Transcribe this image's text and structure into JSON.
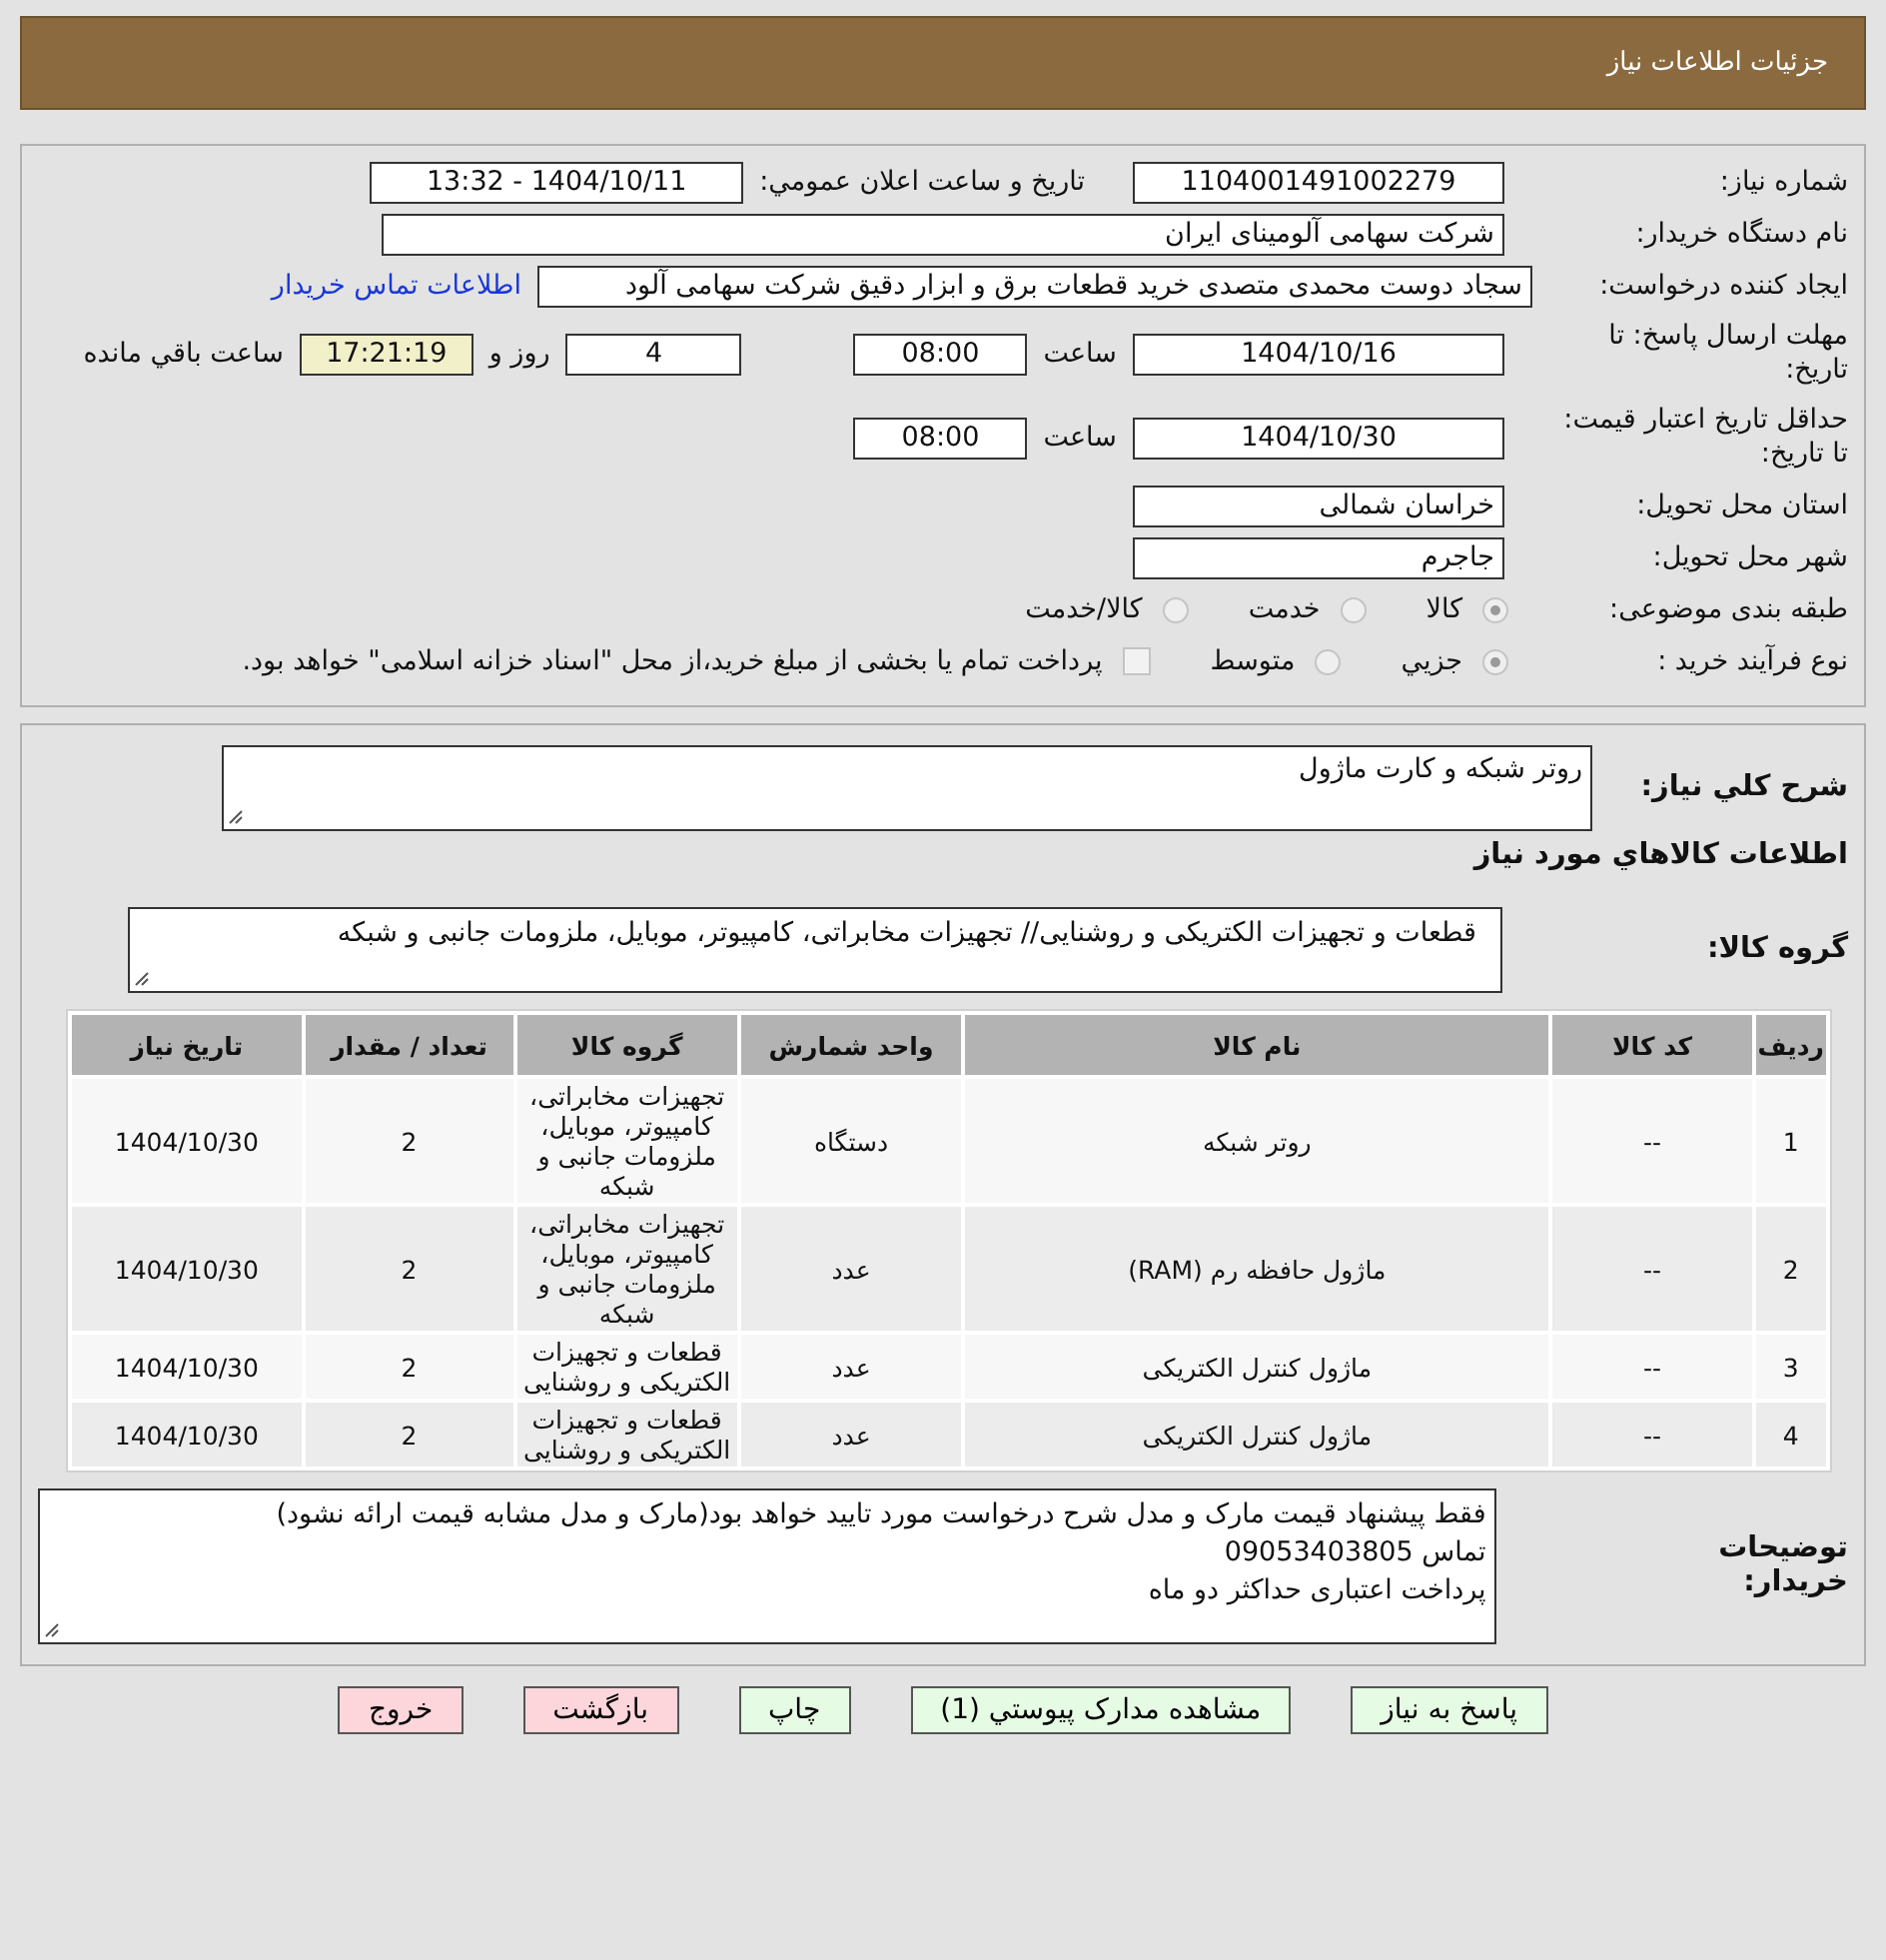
{
  "header": {
    "title": "جزئیات اطلاعات نیاز"
  },
  "need_number": {
    "label": "شماره نیاز:",
    "value": "1104001491002279",
    "announce_label": "تاریخ و ساعت اعلان عمومي:",
    "announce_value": "1404/10/11 - 13:32"
  },
  "buyer": {
    "label": "نام دستگاه خریدار:",
    "value": "شرکت سهامی آلومینای ایران"
  },
  "requester": {
    "label": "ایجاد کننده درخواست:",
    "value": "سجاد دوست محمدی متصدی خرید قطعات برق و ابزار دقیق شرکت سهامی آلود",
    "link": "اطلاعات تماس خریدار"
  },
  "deadline": {
    "label": "مهلت ارسال پاسخ: تا تاریخ:",
    "date": "1404/10/16",
    "time_label": "ساعت",
    "time": "08:00",
    "days": "4",
    "days_label": "روز و",
    "remaining": "17:21:19",
    "remaining_label": "ساعت باقي مانده"
  },
  "validity": {
    "label": "حداقل تاریخ اعتبار قیمت: تا تاریخ:",
    "date": "1404/10/30",
    "time_label": "ساعت",
    "time": "08:00"
  },
  "province": {
    "label": "استان محل تحویل:",
    "value": "خراسان شمالی"
  },
  "city": {
    "label": "شهر محل تحویل:",
    "value": "جاجرم"
  },
  "category": {
    "label": "طبقه بندی موضوعی:",
    "options": [
      {
        "label": "کالا",
        "selected": true
      },
      {
        "label": "خدمت",
        "selected": false
      },
      {
        "label": "کالا/خدمت",
        "selected": false
      }
    ]
  },
  "process": {
    "label": "نوع فرآیند خرید :",
    "options": [
      {
        "label": "جزيي",
        "selected": true
      },
      {
        "label": "متوسط",
        "selected": false
      }
    ],
    "treasury": {
      "label": "پرداخت تمام یا بخشی از مبلغ خرید،از محل \"اسناد خزانه اسلامی\" خواهد بود.",
      "checked": false
    }
  },
  "description": {
    "label": "شرح کلي نیاز:",
    "value": "روتر شبکه و کارت ماژول"
  },
  "goods_heading": "اطلاعات کالاهاي مورد نیاز",
  "goods_group": {
    "label": "گروه کالا:",
    "value": "قطعات و تجهیزات الکتریکی و روشنایی// تجهیزات مخابراتی، کامپیوتر، موبایل، ملزومات جانبی و شبکه"
  },
  "table": {
    "columns": [
      "ردیف",
      "کد کالا",
      "نام کالا",
      "واحد شمارش",
      "گروه کالا",
      "تعداد / مقدار",
      "تاریخ نیاز"
    ],
    "rows": [
      [
        "1",
        "--",
        "روتر شبکه",
        "دستگاه",
        "تجهیزات مخابراتی، کامپیوتر، موبایل، ملزومات جانبی و شبکه",
        "2",
        "1404/10/30"
      ],
      [
        "2",
        "--",
        "ماژول حافظه رم (RAM)",
        "عدد",
        "تجهیزات مخابراتی، کامپیوتر، موبایل، ملزومات جانبی و شبکه",
        "2",
        "1404/10/30"
      ],
      [
        "3",
        "--",
        "ماژول کنترل الکتریکی",
        "عدد",
        "قطعات و تجهیزات الکتریکی و روشنایی",
        "2",
        "1404/10/30"
      ],
      [
        "4",
        "--",
        "ماژول کنترل الکتریکی",
        "عدد",
        "قطعات و تجهیزات الکتریکی و روشنایی",
        "2",
        "1404/10/30"
      ]
    ]
  },
  "notes": {
    "label": "توضیحات خریدار:",
    "lines": [
      "فقط پیشنهاد قیمت مارک و مدل شرح درخواست مورد تایید خواهد بود(مارک و مدل مشابه قیمت ارائه نشود)",
      "تماس 09053403805",
      "پرداخت اعتباری حداکثر دو ماه"
    ]
  },
  "buttons": [
    {
      "label": "پاسخ به نیاز",
      "kind": "action"
    },
    {
      "label": "مشاهده مدارک پیوستي (1)",
      "kind": "action"
    },
    {
      "label": "چاپ",
      "kind": "action"
    },
    {
      "label": "بازگشت",
      "kind": "danger"
    },
    {
      "label": "خروج",
      "kind": "danger"
    }
  ]
}
